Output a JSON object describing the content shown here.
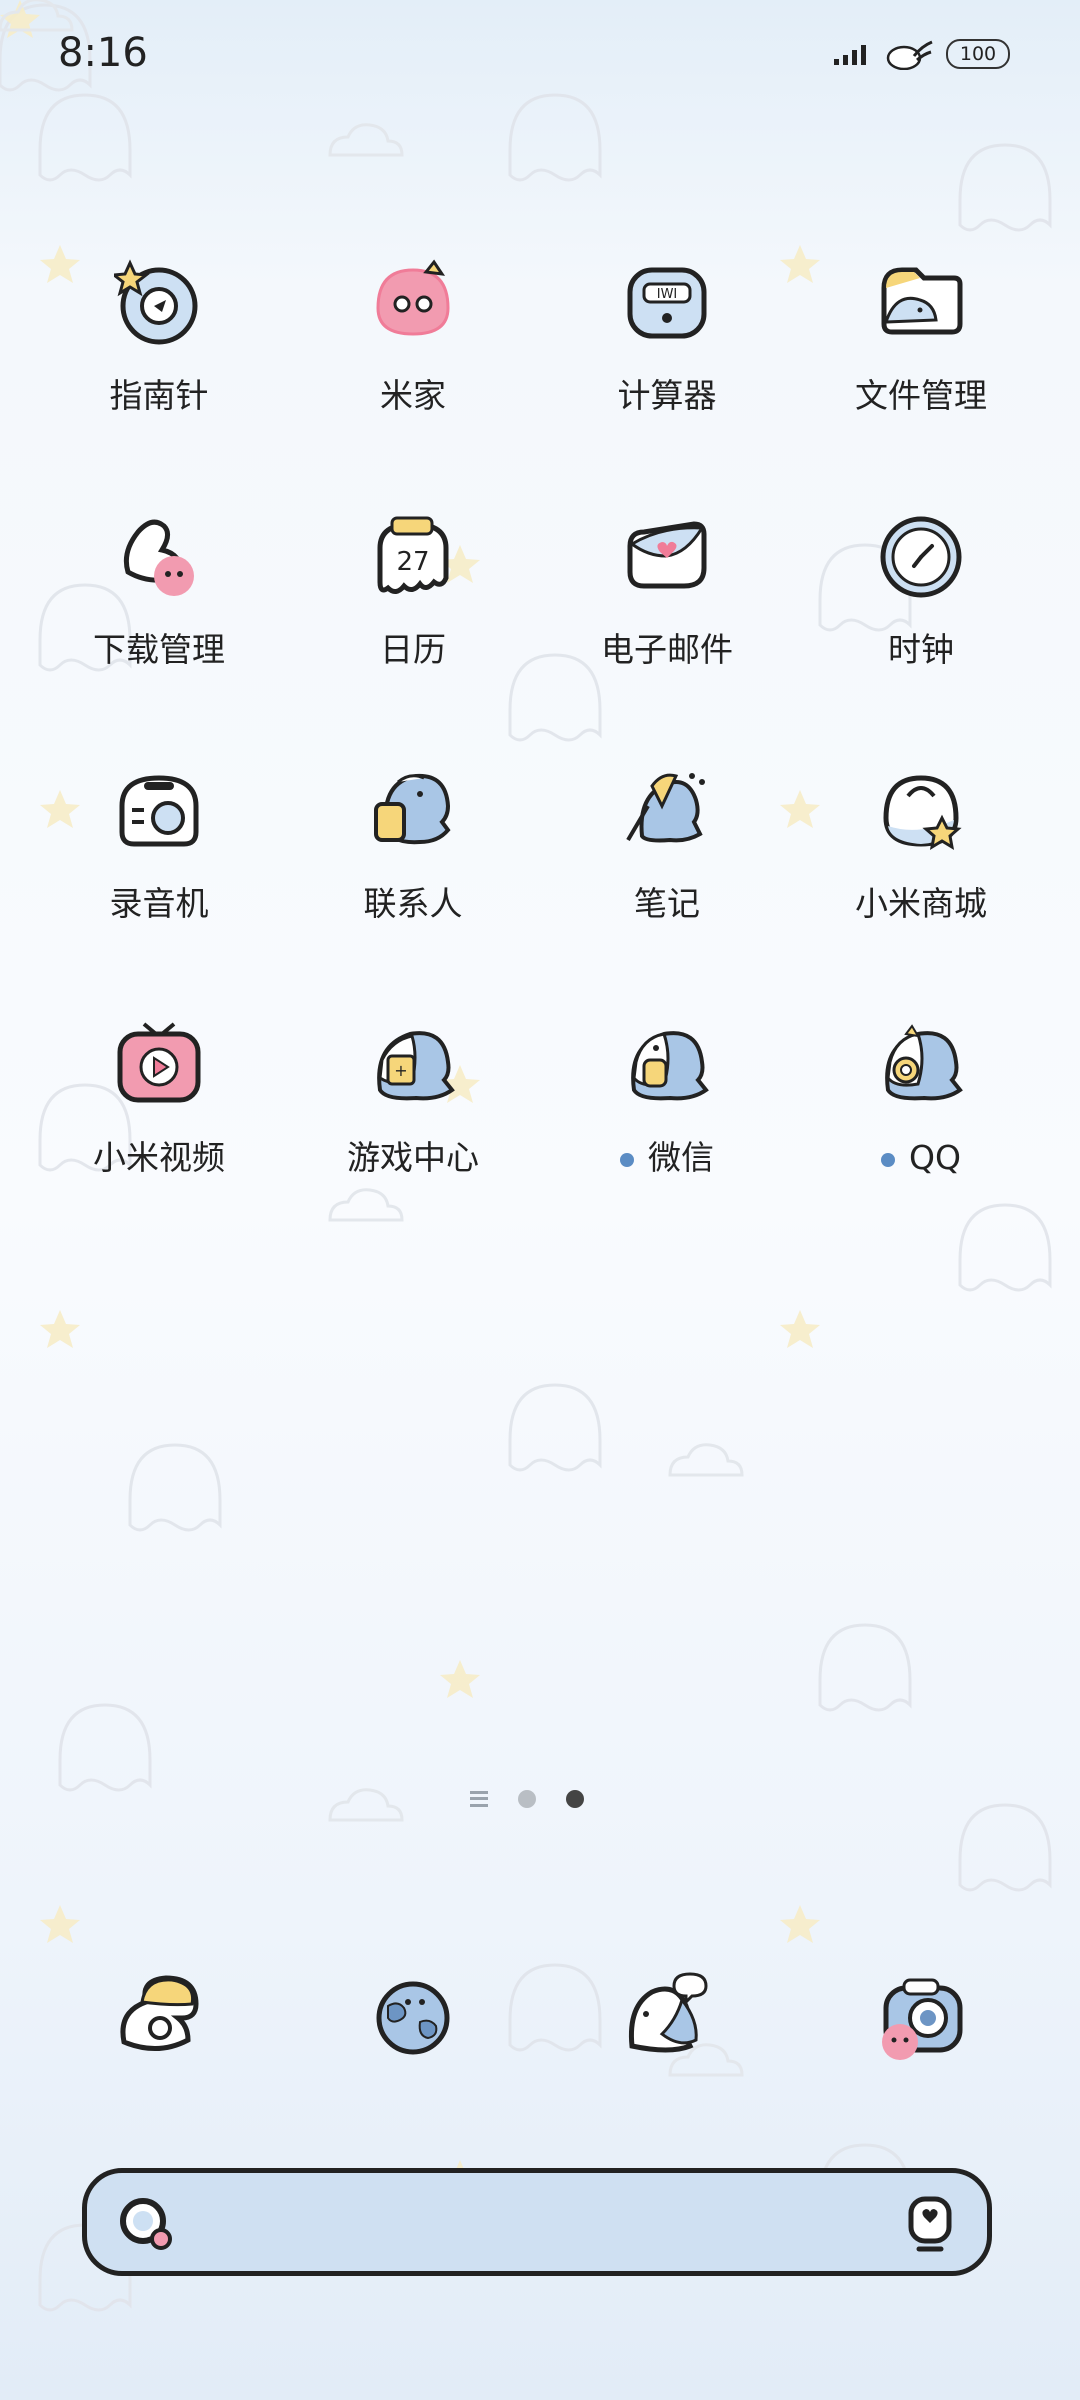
{
  "status_bar": {
    "time": "8:16",
    "battery": "100"
  },
  "apps": [
    {
      "label": "指南针",
      "icon": "compass-icon"
    },
    {
      "label": "米家",
      "icon": "mi-home-icon"
    },
    {
      "label": "计算器",
      "icon": "calculator-icon"
    },
    {
      "label": "文件管理",
      "icon": "file-manager-icon"
    },
    {
      "label": "下载管理",
      "icon": "downloads-icon"
    },
    {
      "label": "日历",
      "icon": "calendar-icon"
    },
    {
      "label": "电子邮件",
      "icon": "email-icon"
    },
    {
      "label": "时钟",
      "icon": "clock-icon"
    },
    {
      "label": "录音机",
      "icon": "recorder-icon"
    },
    {
      "label": "联系人",
      "icon": "contacts-icon"
    },
    {
      "label": "笔记",
      "icon": "notes-icon"
    },
    {
      "label": "小米商城",
      "icon": "mi-store-icon"
    },
    {
      "label": "小米视频",
      "icon": "mi-video-icon"
    },
    {
      "label": "游戏中心",
      "icon": "game-center-icon"
    },
    {
      "label": "微信",
      "icon": "wechat-icon"
    },
    {
      "label": "QQ",
      "icon": "qq-icon"
    }
  ],
  "calendar_day": "27",
  "pager": {
    "pages": 2,
    "current": 2
  },
  "dock": [
    "phone-icon",
    "browser-icon",
    "messages-icon",
    "camera-icon"
  ],
  "search_bar": {
    "left_icon": "search-icon",
    "right_icon": "assistant-icon"
  }
}
